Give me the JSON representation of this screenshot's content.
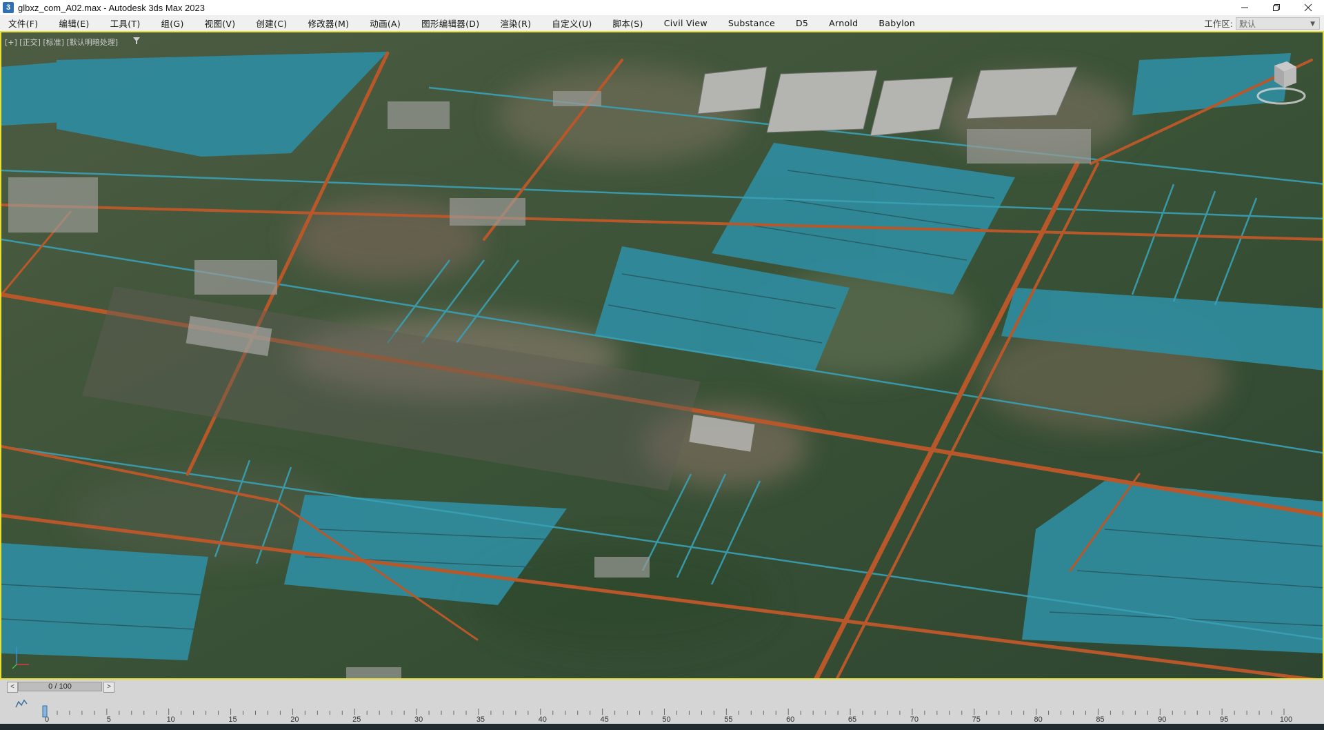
{
  "window": {
    "title": "glbxz_com_A02.max - Autodesk 3ds Max 2023",
    "app_icon_letter": "3"
  },
  "menu": {
    "items": [
      {
        "label": "文件(F)"
      },
      {
        "label": "编辑(E)"
      },
      {
        "label": "工具(T)"
      },
      {
        "label": "组(G)"
      },
      {
        "label": "视图(V)"
      },
      {
        "label": "创建(C)"
      },
      {
        "label": "修改器(M)"
      },
      {
        "label": "动画(A)"
      },
      {
        "label": "图形编辑器(D)"
      },
      {
        "label": "渲染(R)"
      },
      {
        "label": "自定义(U)"
      },
      {
        "label": "脚本(S)"
      },
      {
        "label": "Civil View"
      },
      {
        "label": "Substance"
      },
      {
        "label": "D5"
      },
      {
        "label": "Arnold"
      },
      {
        "label": "Babylon"
      }
    ],
    "workspace_label": "工作区:",
    "workspace_value": "默认"
  },
  "viewport": {
    "label": "[+] [正交] [标准] [默认明暗处理]",
    "active_border_color": "#e7df3a",
    "colors": {
      "water": "#2f8a9c",
      "road": "#b8582a",
      "ground": "#3c5238"
    }
  },
  "timeline": {
    "frame_display": "0 / 100",
    "current_frame": 0,
    "start": 0,
    "end": 100,
    "major_labels": [
      "0",
      "5",
      "10",
      "15",
      "20",
      "25",
      "30",
      "35",
      "40",
      "45",
      "50",
      "55",
      "60",
      "65",
      "70",
      "75",
      "80",
      "85",
      "90",
      "95",
      "100"
    ]
  }
}
